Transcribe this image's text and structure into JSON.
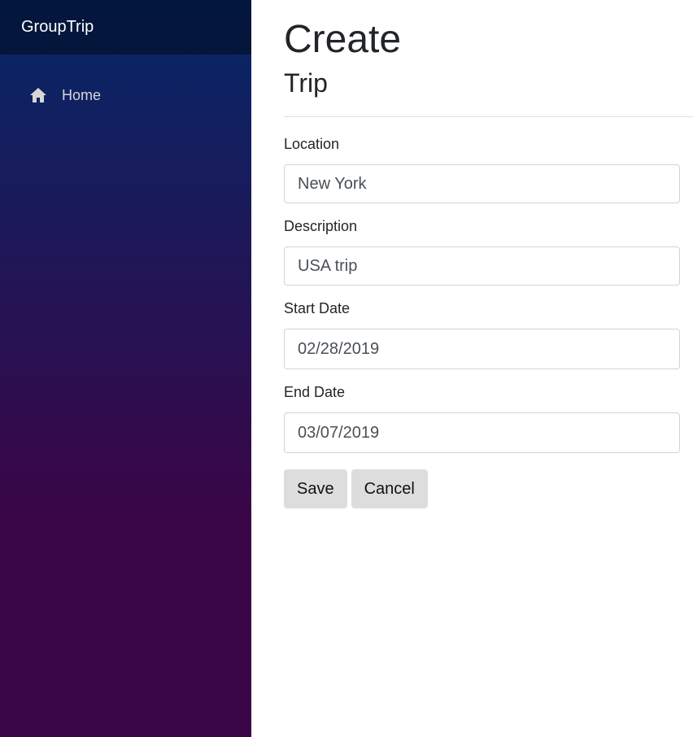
{
  "sidebar": {
    "brand": "GroupTrip",
    "items": [
      {
        "label": "Home",
        "icon": "home-icon"
      }
    ],
    "colors": {
      "top": "#052767",
      "bottom": "#3a0647"
    }
  },
  "main": {
    "title": "Create",
    "subtitle": "Trip",
    "fields": {
      "location": {
        "label": "Location",
        "value": "New York"
      },
      "description": {
        "label": "Description",
        "value": "USA trip"
      },
      "start_date": {
        "label": "Start Date",
        "value": "02/28/2019"
      },
      "end_date": {
        "label": "End Date",
        "value": "03/07/2019"
      }
    },
    "actions": {
      "save_label": "Save",
      "cancel_label": "Cancel"
    }
  }
}
